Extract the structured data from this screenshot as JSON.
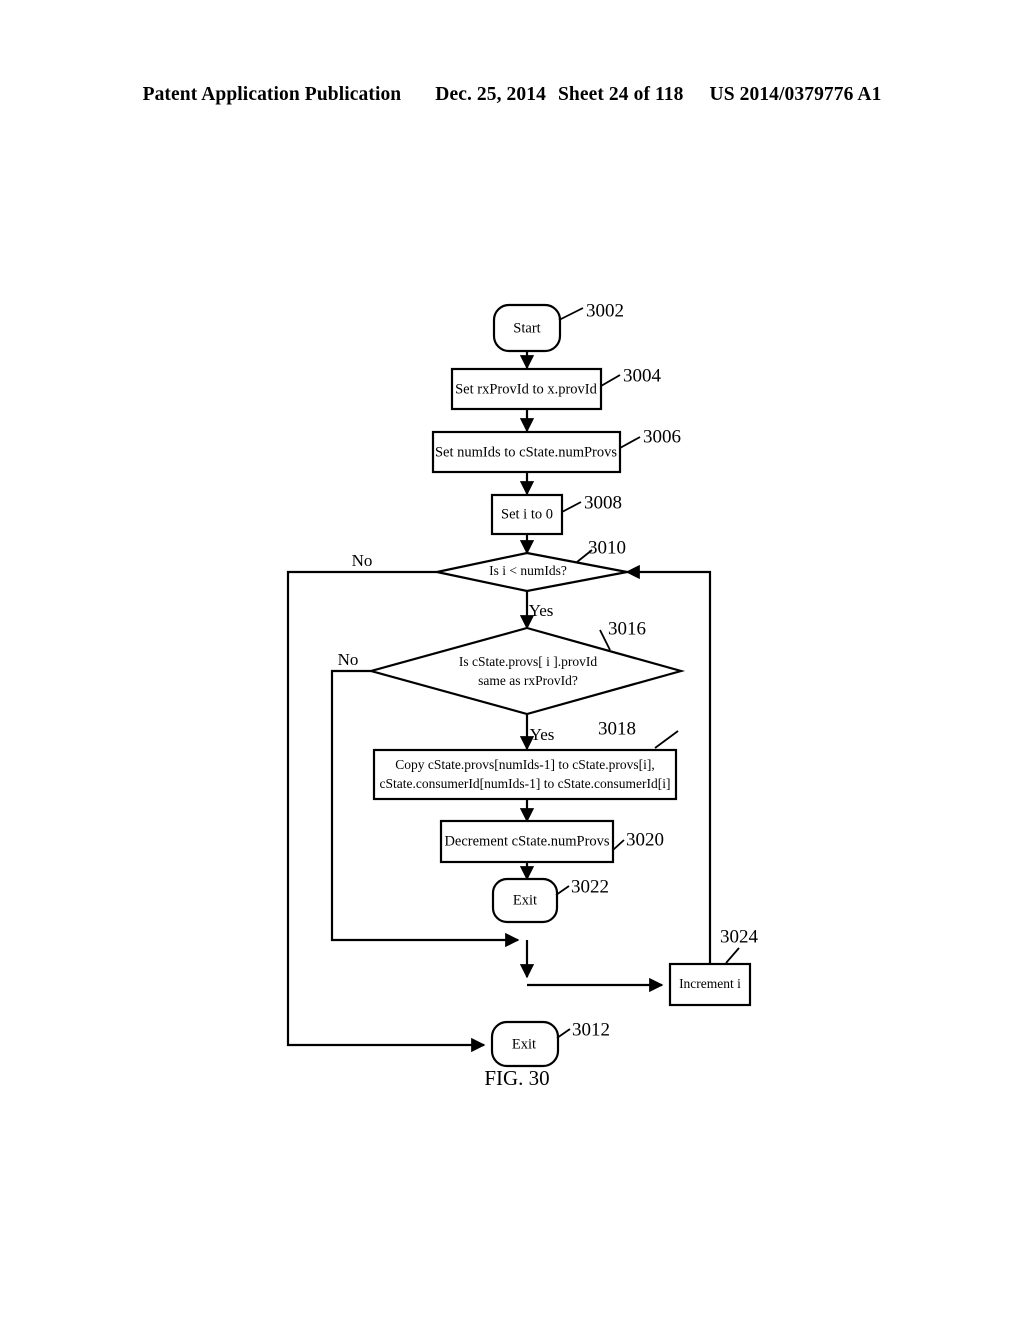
{
  "header": {
    "publication": "Patent Application Publication",
    "date": "Dec. 25, 2014",
    "sheet": "Sheet 24 of 118",
    "patent_number": "US 2014/0379776 A1"
  },
  "figure": {
    "caption": "FIG. 30"
  },
  "nodes": {
    "start": {
      "label": "Start",
      "ref": "3002"
    },
    "set_rx_prov_id": {
      "label": "Set rxProvId to x.provId",
      "ref": "3004"
    },
    "set_num_ids": {
      "label": "Set numIds to cState.numProvs",
      "ref": "3006"
    },
    "set_i_zero": {
      "label": "Set i to 0",
      "ref": "3008"
    },
    "decision_i_lt_numids": {
      "label": "Is i < numIds?",
      "ref": "3010"
    },
    "decision_prov_match": {
      "label_line1": "Is cState.provs[ i ].provId",
      "label_line2": "same as rxProvId?",
      "ref": "3016"
    },
    "copy_entries": {
      "label_line1": "Copy cState.provs[numIds-1] to cState.provs[i],",
      "label_line2": "cState.consumerId[numIds-1] to cState.consumerId[i]",
      "ref": "3018"
    },
    "decrement_num_provs": {
      "label": "Decrement cState.numProvs",
      "ref": "3020"
    },
    "exit_found": {
      "label": "Exit",
      "ref": "3022"
    },
    "increment_i": {
      "label": "Increment i",
      "ref": "3024"
    },
    "exit_loop_end": {
      "label": "Exit",
      "ref": "3012"
    }
  },
  "branch_labels": {
    "i_lt_numids_no": "No",
    "i_lt_numids_yes": "Yes",
    "prov_match_no": "No",
    "prov_match_yes": "Yes"
  },
  "colors": {
    "ink": "#000000",
    "paper": "#ffffff"
  }
}
